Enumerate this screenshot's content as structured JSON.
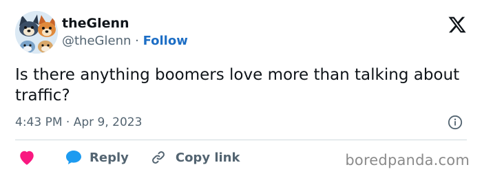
{
  "author": {
    "display_name": "theGlenn",
    "handle": "@theGlenn",
    "separator": " · ",
    "follow_label": "Follow",
    "avatar_icon": "cartoon-dogs-avatar"
  },
  "platform": {
    "logo_icon": "x-logo"
  },
  "tweet": {
    "text": "Is there anything boomers love more than talking about traffic?",
    "timestamp": "4:43 PM · Apr 9, 2023",
    "info_icon": "info-icon"
  },
  "actions": {
    "like_icon": "heart-icon",
    "reply_label": "Reply",
    "reply_icon": "speech-bubble-icon",
    "copy_label": "Copy link",
    "copy_icon": "link-icon"
  },
  "watermark": {
    "text": "boredpanda.com"
  },
  "colors": {
    "accent": "#1d6ec5",
    "heart": "#f91880",
    "reply": "#1d9bf0",
    "secondary_text": "#536471",
    "primary_text": "#0f1419"
  }
}
